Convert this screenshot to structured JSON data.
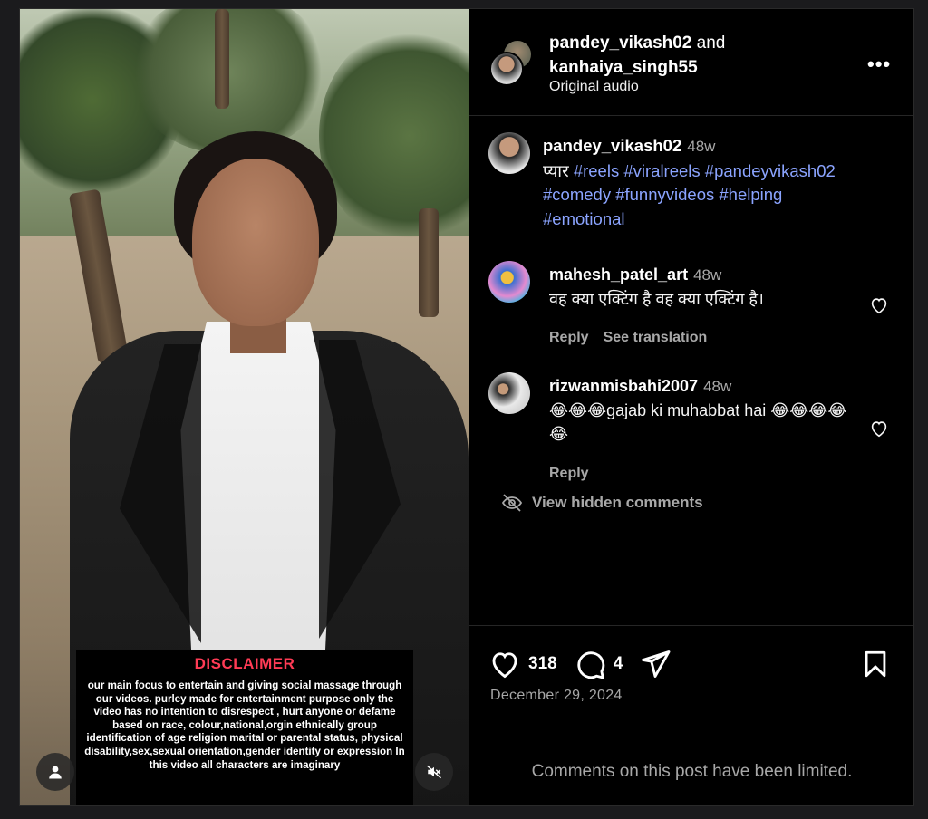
{
  "header": {
    "user1": "pandey_vikash02",
    "and_text": "and",
    "user2": "kanhaiya_singh55",
    "audio": "Original audio",
    "more_glyph": "•••"
  },
  "post": {
    "username": "pandey_vikash02",
    "time": "48w",
    "caption_word": "प्यार",
    "hashtags": [
      "#reels",
      "#viralreels",
      "#pandeyvikash02",
      "#comedy",
      "#funnyvideos",
      "#helping",
      "#emotional"
    ]
  },
  "comments": [
    {
      "username": "mahesh_patel_art",
      "time": "48w",
      "text": "वह क्या एक्टिंग है वह क्या एक्टिंग है।",
      "reply_label": "Reply",
      "translate_label": "See translation"
    },
    {
      "username": "rizwanmisbahi2007",
      "time": "48w",
      "text": "😂😂😂gajab ki muhabbat hai 😂😂😂😂😂",
      "reply_label": "Reply"
    }
  ],
  "hidden_comments_label": "View hidden comments",
  "stats": {
    "likes": "318",
    "comments": "4",
    "date": "December 29, 2024",
    "limited_notice": "Comments on this post have been limited."
  },
  "video": {
    "disclaimer_title": "DISCLAIMER",
    "disclaimer_text": "our main focus to entertain and giving social massage through our videos. purley made for entertainment purpose only the video has no intention to disrespect , hurt anyone or defame based on race, colour,national,orgin ethnically group identification of age religion marital or parental status, physical disability,sex,sexual orientation,gender identity or expression In this video all characters are imaginary"
  },
  "colors": {
    "background": "#000000",
    "hashtag": "#8ba4ff",
    "secondary_text": "#a8a8a8",
    "disclaimer_title": "#ff3b55"
  },
  "icons": [
    "more-icon",
    "heart-icon",
    "comment-icon",
    "share-icon",
    "bookmark-icon",
    "eye-off-icon",
    "user-icon",
    "mute-icon"
  ]
}
